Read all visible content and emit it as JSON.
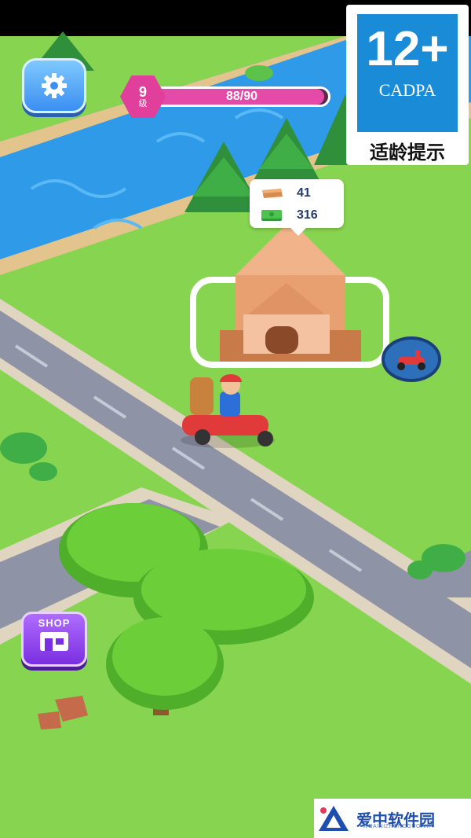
{
  "hud": {
    "level": {
      "number": "9",
      "unit": "级",
      "progress_text": "88/90",
      "progress_fraction": 0.978
    },
    "resources": {
      "bricks": "41",
      "cash": "316"
    },
    "shop_label": "SHOP"
  },
  "rating_badge": {
    "age": "12+",
    "org": "CADPA",
    "tip": "适龄提示"
  },
  "watermark": {
    "name": "爱中软件园",
    "url": "WOAINIZHONGGUO.VIP"
  },
  "colors": {
    "accent_pink": "#e64aa8",
    "grass": "#7fd14a",
    "water": "#2f9be8",
    "road": "#8f93a6"
  },
  "icons": [
    "gear-icon",
    "brick-icon",
    "cash-icon",
    "moped-icon",
    "shop-icon"
  ]
}
